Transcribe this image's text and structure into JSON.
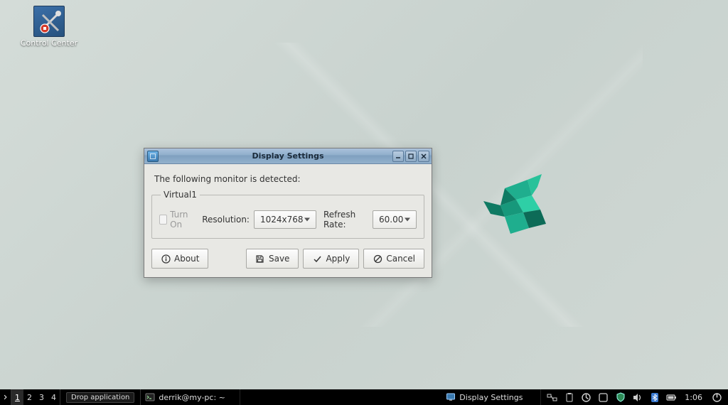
{
  "desktop": {
    "icons": [
      {
        "name": "control-center",
        "label": "Control Center"
      }
    ]
  },
  "dialog": {
    "title": "Display Settings",
    "detected_text": "The following monitor is detected:",
    "monitor": {
      "name": "Virtual1",
      "turn_on_label": "Turn On",
      "turn_on_enabled": false,
      "resolution_label": "Resolution:",
      "resolution_value": "1024x768",
      "refresh_label": "Refresh Rate:",
      "refresh_value": "60.00"
    },
    "buttons": {
      "about": "About",
      "save": "Save",
      "apply": "Apply",
      "cancel": "Cancel"
    }
  },
  "taskbar": {
    "workspaces": [
      "1",
      "2",
      "3",
      "4"
    ],
    "active_workspace": 0,
    "drop_app_label": "Drop application",
    "tasks": [
      {
        "id": "terminal",
        "label": "derrik@my-pc: ~",
        "icon": "terminal-icon",
        "active": false
      },
      {
        "id": "display-settings",
        "label": "Display Settings",
        "icon": "display-icon",
        "active": false
      }
    ],
    "clock": "1:06"
  }
}
